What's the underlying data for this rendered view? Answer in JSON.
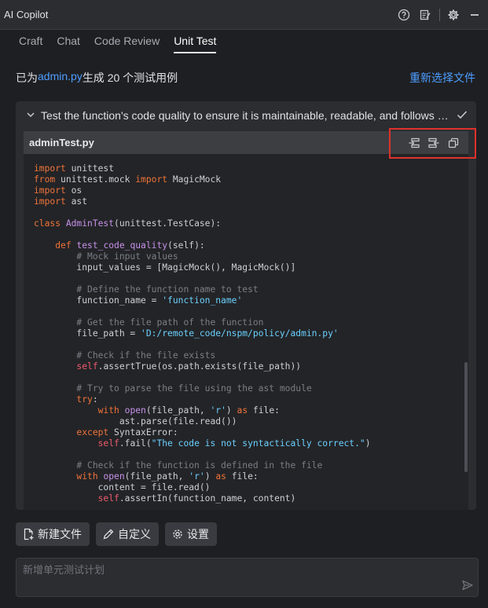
{
  "app": {
    "title": "AI Copilot"
  },
  "titlebar_icons": [
    "help-icon",
    "notes-icon",
    "gear-icon",
    "minimize-icon"
  ],
  "tabs": [
    {
      "label": "Craft"
    },
    {
      "label": "Chat"
    },
    {
      "label": "Code Review"
    },
    {
      "label": "Unit Test",
      "active": true
    }
  ],
  "status": {
    "prefix": "已为 ",
    "file": "admin.py",
    "suffix": " 生成 20 个测试用例",
    "reselect_label": "重新选择文件"
  },
  "test_case": {
    "title": "Test the function's code quality to ensure it is maintainable, readable, and follows best pr...",
    "file_name": "adminTest.py",
    "action_icons": [
      "insert-left-icon",
      "insert-right-icon",
      "copy-icon"
    ]
  },
  "colors": {
    "accent": "#4e9dff",
    "highlight_border": "#e0312b",
    "keyword": "#f0743a",
    "function": "#c792ea",
    "string": "#6bd0ff",
    "comment": "#7a7e86"
  },
  "buttons": {
    "new_file": "新建文件",
    "customize": "自定义",
    "settings": "设置"
  },
  "input": {
    "placeholder": "新增单元测试计划",
    "value": ""
  }
}
